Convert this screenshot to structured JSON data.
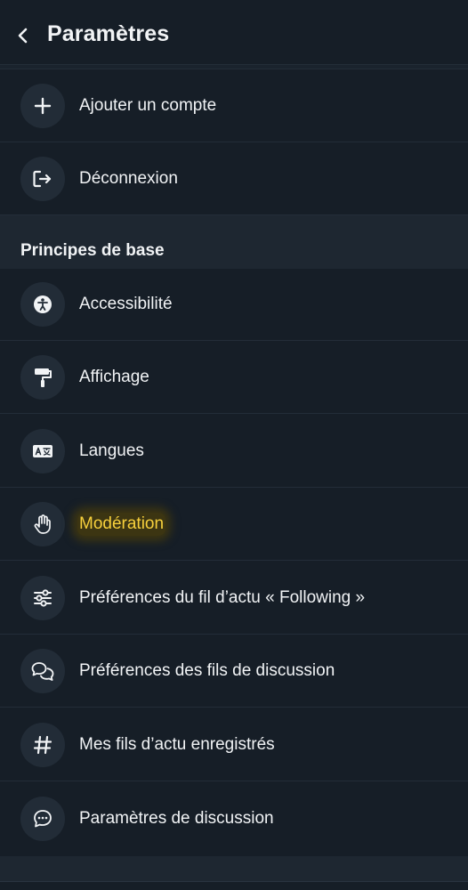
{
  "header": {
    "title": "Paramètres",
    "back_icon": "chevron-left-icon"
  },
  "accounts": {
    "items": [
      {
        "label": "Ajouter un compte",
        "icon": "plus-icon"
      },
      {
        "label": "Déconnexion",
        "icon": "sign-out-icon"
      }
    ]
  },
  "basics": {
    "section_title": "Principes de base",
    "items": [
      {
        "label": "Accessibilité",
        "icon": "accessibility-icon"
      },
      {
        "label": "Affichage",
        "icon": "paint-roller-icon"
      },
      {
        "label": "Langues",
        "icon": "language-icon"
      },
      {
        "label": "Modération",
        "icon": "hand-icon",
        "highlighted": true
      },
      {
        "label": "Préférences du fil d’actu « Following »",
        "icon": "filter-sliders-icon"
      },
      {
        "label": "Préférences des fils de discussion",
        "icon": "chat-bubbles-icon"
      },
      {
        "label": "Mes fils d’actu enregistrés",
        "icon": "hashtag-icon"
      },
      {
        "label": "Paramètres de discussion",
        "icon": "message-dots-icon"
      }
    ]
  },
  "colors": {
    "background": "#161e27",
    "section_band": "#1e2731",
    "icon_circle": "#222c37",
    "text": "#f1f3f5",
    "highlight_text": "#f7d03c",
    "highlight_bg": "#3c3512"
  }
}
